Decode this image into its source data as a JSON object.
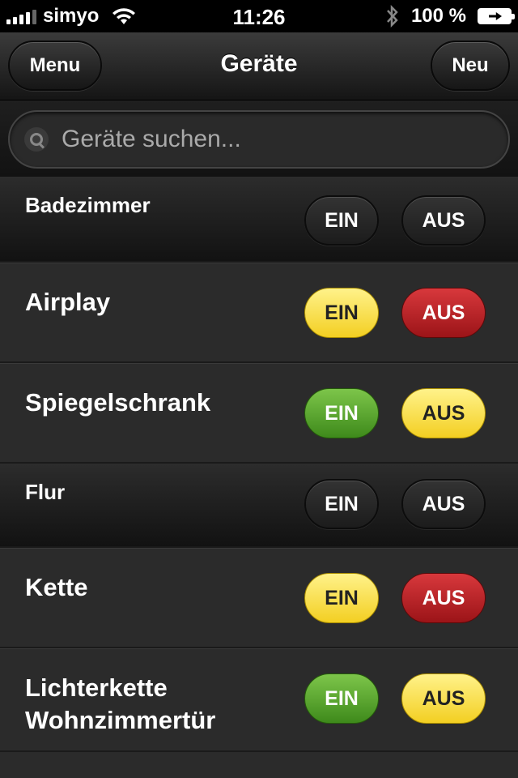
{
  "statusbar": {
    "carrier": "simyo",
    "time": "11:26",
    "battery_percent": "100 %"
  },
  "navbar": {
    "title": "Geräte",
    "left_button": "Menu",
    "right_button": "Neu"
  },
  "search": {
    "placeholder": "Geräte suchen..."
  },
  "rows": [
    {
      "type": "group",
      "label": "Badezimmer",
      "ein": "EIN",
      "aus": "AUS",
      "ein_color": "dark",
      "aus_color": "dark"
    },
    {
      "type": "device",
      "label": "Airplay",
      "ein": "EIN",
      "aus": "AUS",
      "ein_color": "yellow",
      "aus_color": "red"
    },
    {
      "type": "device",
      "label": "Spiegelschrank",
      "ein": "EIN",
      "aus": "AUS",
      "ein_color": "green",
      "aus_color": "yellow"
    },
    {
      "type": "group",
      "label": "Flur",
      "ein": "EIN",
      "aus": "AUS",
      "ein_color": "dark",
      "aus_color": "dark"
    },
    {
      "type": "device",
      "label": "Kette",
      "ein": "EIN",
      "aus": "AUS",
      "ein_color": "yellow",
      "aus_color": "red"
    },
    {
      "type": "device",
      "label": "Lichterkette Wohnzimmertür",
      "ein": "EIN",
      "aus": "AUS",
      "ein_color": "green",
      "aus_color": "yellow"
    }
  ],
  "colors": {
    "yellow": "#f3cf22",
    "red": "#b41e22",
    "green": "#4e9a27",
    "dark": "#222222"
  }
}
